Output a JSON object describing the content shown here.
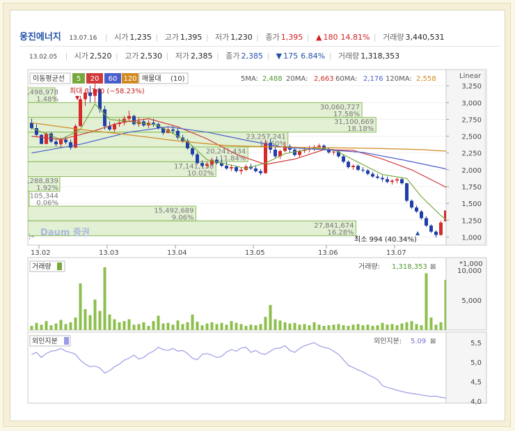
{
  "header": {
    "stock_name": "웅진에너지",
    "date": "13.07.16",
    "open_label": "시가",
    "open": "1,235",
    "high_label": "고가",
    "high": "1,395",
    "low_label": "저가",
    "low": "1,230",
    "close_label": "종가",
    "close": "1,395",
    "change_arrow": "▲",
    "change": "180",
    "change_pct": "14.81%",
    "volume_label": "거래량",
    "volume": "3,440,531"
  },
  "cursor_info": {
    "date": "13.02.05",
    "open_label": "시가",
    "open": "2,520",
    "high_label": "고가",
    "high": "2,530",
    "low_label": "저가",
    "low": "2,385",
    "close_label": "종가",
    "close": "2,385",
    "change_arrow": "▼",
    "change": "175",
    "change_pct": "6.84%",
    "volume_label": "거래량",
    "volume": "1,318,353"
  },
  "price_panel": {
    "ma_button": "이동평균선",
    "ma_periods": [
      "5",
      "20",
      "60",
      "120"
    ],
    "ma_colors": [
      "#78a83c",
      "#d03a3a",
      "#4a5dcc",
      "#d08a20"
    ],
    "volume_profile_button": "매물대",
    "volume_profile_count": "(10)",
    "ma_values": [
      {
        "label": "5MA:",
        "value": "2,488",
        "color": "#4c9a2a"
      },
      {
        "label": "20MA:",
        "value": "2,663",
        "color": "#d02a2a"
      },
      {
        "label": "60MA:",
        "value": "2,176",
        "color": "#4a5dcc"
      },
      {
        "label": "120MA:",
        "value": "2,558",
        "color": "#d08a20"
      }
    ],
    "scale_label": "Linear",
    "watermark": "Daum 증권",
    "max_label": "최대 3,340 (−58.23%)",
    "min_label": "최소 994 (40.34%)",
    "profile_labels": [
      {
        "volume": "2,498,978",
        "pct": "1.48%"
      },
      {
        "volume": "30,060,727",
        "pct": "17.58%"
      },
      {
        "volume": "31,100,669",
        "pct": "18.18%"
      },
      {
        "volume": "23,257,241",
        "pct": "13.60%"
      },
      {
        "volume": "20,241,434",
        "pct": "11.84%"
      },
      {
        "volume": "17,141,158",
        "pct": "10.02%"
      },
      {
        "volume": "3,288,839",
        "pct": "1.92%"
      },
      {
        "volume": "105,344",
        "pct": "0.06%"
      },
      {
        "volume": "15,492,689",
        "pct": "9.06%"
      },
      {
        "volume": "27,841,674",
        "pct": "16.28%"
      }
    ]
  },
  "volume_panel": {
    "button": "거래량",
    "multiplier": "*1,000",
    "value_label": "거래량:",
    "value": "1,318,353"
  },
  "foreign_panel": {
    "button": "외인지분",
    "value_label": "외인지분:",
    "value": "5.09"
  },
  "chart_data": [
    {
      "type": "candlestick",
      "title": "",
      "x_tick_labels": [
        "13.02",
        "13.03",
        "13.04",
        "13.05",
        "13.06",
        "13.07"
      ],
      "y_ticks": [
        1000,
        1250,
        1500,
        1750,
        2000,
        2250,
        2500,
        2750,
        3000,
        3250
      ],
      "y_tick_labels": [
        "1,000",
        "1,250",
        "1,500",
        "1,750",
        "2,000",
        "2,250",
        "2,500",
        "2,750",
        "3,000",
        "3,250"
      ],
      "ylim": [
        880,
        3480
      ],
      "n_periods": 96,
      "candles": [
        [
          2700,
          2760,
          2600,
          2620
        ],
        [
          2620,
          2680,
          2500,
          2520
        ],
        [
          2520,
          2530,
          2385,
          2385
        ],
        [
          2385,
          2560,
          2380,
          2540
        ],
        [
          2540,
          2560,
          2400,
          2420
        ],
        [
          2420,
          2450,
          2350,
          2380
        ],
        [
          2380,
          2480,
          2330,
          2450
        ],
        [
          2450,
          2500,
          2380,
          2410
        ],
        [
          2410,
          2450,
          2300,
          2330
        ],
        [
          2330,
          2680,
          2320,
          2650
        ],
        [
          2650,
          3100,
          2640,
          3050
        ],
        [
          3050,
          3200,
          2950,
          3150
        ],
        [
          3150,
          3250,
          3000,
          3100
        ],
        [
          3100,
          3340,
          3000,
          3200
        ],
        [
          3200,
          3220,
          2850,
          2900
        ],
        [
          2900,
          2950,
          2600,
          2650
        ],
        [
          2650,
          2720,
          2580,
          2600
        ],
        [
          2600,
          2700,
          2560,
          2680
        ],
        [
          2680,
          2760,
          2640,
          2700
        ],
        [
          2700,
          2800,
          2660,
          2760
        ],
        [
          2760,
          2880,
          2720,
          2800
        ],
        [
          2800,
          2820,
          2660,
          2680
        ],
        [
          2680,
          2780,
          2640,
          2720
        ],
        [
          2720,
          2760,
          2640,
          2660
        ],
        [
          2660,
          2740,
          2620,
          2700
        ],
        [
          2700,
          2760,
          2640,
          2680
        ],
        [
          2680,
          2700,
          2600,
          2620
        ],
        [
          2620,
          2640,
          2520,
          2550
        ],
        [
          2550,
          2640,
          2540,
          2600
        ],
        [
          2600,
          2660,
          2540,
          2580
        ],
        [
          2580,
          2620,
          2450,
          2480
        ],
        [
          2480,
          2520,
          2400,
          2430
        ],
        [
          2430,
          2460,
          2300,
          2320
        ],
        [
          2320,
          2350,
          2200,
          2230
        ],
        [
          2230,
          2260,
          2080,
          2100
        ],
        [
          2100,
          2140,
          2040,
          2060
        ],
        [
          2060,
          2120,
          2030,
          2080
        ],
        [
          2080,
          2180,
          2060,
          2150
        ],
        [
          2150,
          2200,
          2080,
          2100
        ],
        [
          2100,
          2150,
          2040,
          2060
        ],
        [
          2060,
          2120,
          2000,
          2020
        ],
        [
          2020,
          2080,
          1980,
          2040
        ],
        [
          2040,
          2060,
          1960,
          1980
        ],
        [
          1980,
          2040,
          1930,
          2000
        ],
        [
          2000,
          2080,
          1980,
          2050
        ],
        [
          2050,
          2090,
          2000,
          2020
        ],
        [
          2020,
          2060,
          1960,
          1980
        ],
        [
          1980,
          2010,
          1920,
          1950
        ],
        [
          1950,
          2450,
          1940,
          2400
        ],
        [
          2400,
          2460,
          2250,
          2300
        ],
        [
          2300,
          2340,
          2180,
          2200
        ],
        [
          2200,
          2300,
          2160,
          2280
        ],
        [
          2280,
          2420,
          2260,
          2350
        ],
        [
          2350,
          2380,
          2260,
          2300
        ],
        [
          2300,
          2320,
          2200,
          2220
        ],
        [
          2220,
          2300,
          2180,
          2280
        ],
        [
          2280,
          2340,
          2250,
          2300
        ],
        [
          2300,
          2360,
          2260,
          2320
        ],
        [
          2320,
          2370,
          2280,
          2340
        ],
        [
          2340,
          2390,
          2300,
          2360
        ],
        [
          2360,
          2380,
          2290,
          2310
        ],
        [
          2310,
          2330,
          2240,
          2260
        ],
        [
          2260,
          2300,
          2220,
          2270
        ],
        [
          2270,
          2290,
          2180,
          2200
        ],
        [
          2200,
          2220,
          2100,
          2120
        ],
        [
          2120,
          2140,
          2020,
          2040
        ],
        [
          2040,
          2080,
          2000,
          2060
        ],
        [
          2060,
          2080,
          1980,
          2000
        ],
        [
          2000,
          2040,
          1960,
          1990
        ],
        [
          1990,
          2010,
          1920,
          1940
        ],
        [
          1940,
          1970,
          1880,
          1900
        ],
        [
          1900,
          1940,
          1860,
          1880
        ],
        [
          1880,
          1920,
          1820,
          1860
        ],
        [
          1860,
          1900,
          1800,
          1820
        ],
        [
          1820,
          1860,
          1780,
          1840
        ],
        [
          1840,
          1880,
          1800,
          1860
        ],
        [
          1860,
          1880,
          1780,
          1800
        ],
        [
          1800,
          1810,
          1520,
          1540
        ],
        [
          1540,
          1560,
          1420,
          1440
        ],
        [
          1440,
          1470,
          1360,
          1380
        ],
        [
          1380,
          1400,
          1260,
          1280
        ],
        [
          1280,
          1310,
          1150,
          1170
        ],
        [
          1170,
          1190,
          1060,
          1080
        ],
        [
          1080,
          1100,
          994,
          1030
        ],
        [
          1030,
          1240,
          1020,
          1215
        ],
        [
          1235,
          1395,
          1230,
          1395
        ]
      ],
      "ma_series": [
        {
          "name": "5",
          "points": [
            [
              0,
              2620
            ],
            [
              6,
              2450
            ],
            [
              10,
              2600
            ],
            [
              13,
              2980
            ],
            [
              16,
              2750
            ],
            [
              20,
              2720
            ],
            [
              26,
              2660
            ],
            [
              32,
              2420
            ],
            [
              36,
              2150
            ],
            [
              44,
              2020
            ],
            [
              48,
              2100
            ],
            [
              52,
              2240
            ],
            [
              58,
              2320
            ],
            [
              62,
              2300
            ],
            [
              66,
              2150
            ],
            [
              72,
              1930
            ],
            [
              77,
              1870
            ],
            [
              80,
              1600
            ],
            [
              84,
              1320
            ],
            [
              87,
              1150
            ],
            [
              89,
              1180
            ]
          ]
        },
        {
          "name": "20",
          "points": [
            [
              0,
              2500
            ],
            [
              6,
              2450
            ],
            [
              12,
              2560
            ],
            [
              18,
              2700
            ],
            [
              24,
              2760
            ],
            [
              30,
              2640
            ],
            [
              36,
              2460
            ],
            [
              42,
              2230
            ],
            [
              48,
              2080
            ],
            [
              54,
              2160
            ],
            [
              60,
              2300
            ],
            [
              66,
              2290
            ],
            [
              72,
              2160
            ],
            [
              78,
              2000
            ],
            [
              84,
              1780
            ],
            [
              89,
              1580
            ]
          ]
        },
        {
          "name": "60",
          "points": [
            [
              0,
              2250
            ],
            [
              10,
              2380
            ],
            [
              20,
              2560
            ],
            [
              28,
              2640
            ],
            [
              36,
              2560
            ],
            [
              44,
              2440
            ],
            [
              52,
              2330
            ],
            [
              60,
              2300
            ],
            [
              68,
              2260
            ],
            [
              76,
              2150
            ],
            [
              84,
              2030
            ],
            [
              89,
              1950
            ]
          ]
        },
        {
          "name": "120",
          "points": [
            [
              0,
              2700
            ],
            [
              10,
              2600
            ],
            [
              20,
              2520
            ],
            [
              30,
              2430
            ],
            [
              40,
              2360
            ],
            [
              50,
              2340
            ],
            [
              60,
              2330
            ],
            [
              70,
              2320
            ],
            [
              80,
              2300
            ],
            [
              89,
              2260
            ]
          ]
        }
      ],
      "volume_profile": [
        {
          "price_from": 3000,
          "price_to": 3220,
          "pct": 6.8
        },
        {
          "price_from": 2780,
          "price_to": 3000,
          "pct": 83.5
        },
        {
          "price_from": 2560,
          "price_to": 2780,
          "pct": 87.0
        },
        {
          "price_from": 2340,
          "price_to": 2560,
          "pct": 65.0
        },
        {
          "price_from": 2120,
          "price_to": 2340,
          "pct": 55.0
        },
        {
          "price_from": 1900,
          "price_to": 2120,
          "pct": 47.0
        },
        {
          "price_from": 1680,
          "price_to": 1900,
          "pct": 8.0
        },
        {
          "price_from": 1460,
          "price_to": 1680,
          "pct": 0.3
        },
        {
          "price_from": 1240,
          "price_to": 1460,
          "pct": 42.0
        },
        {
          "price_from": 1020,
          "price_to": 1240,
          "pct": 82.0
        }
      ]
    },
    {
      "type": "bar",
      "title": "",
      "y_ticks": [
        5000,
        10000
      ],
      "y_tick_labels": [
        "5,000",
        "10,000"
      ],
      "ylim": [
        0,
        12000
      ],
      "values": [
        700,
        1200,
        900,
        1500,
        800,
        1100,
        1700,
        1000,
        1300,
        2100,
        7800,
        3500,
        2500,
        5100,
        3200,
        10500,
        2600,
        1800,
        1300,
        1500,
        1800,
        900,
        1000,
        1300,
        700,
        1500,
        2400,
        1100,
        1200,
        900,
        1600,
        1000,
        1300,
        2600,
        1400,
        800,
        1100,
        1300,
        1000,
        1200,
        900,
        1500,
        1200,
        1000,
        700,
        900,
        800,
        1000,
        2200,
        4200,
        1800,
        1600,
        1300,
        1100,
        1200,
        900,
        1000,
        800,
        1300,
        900,
        700,
        800,
        900,
        1000,
        800,
        700,
        900,
        1000,
        800,
        900,
        700,
        800,
        1200,
        900,
        1000,
        800,
        1100,
        1300,
        1500,
        1000,
        800,
        9500,
        2100,
        900,
        1300,
        8400,
        10200,
        6200,
        3100
      ]
    },
    {
      "type": "line",
      "title": "",
      "y_ticks": [
        4.0,
        4.5,
        5.0,
        5.5
      ],
      "y_tick_labels": [
        "4,0",
        "4,5",
        "5,0",
        "5,5"
      ],
      "ylim": [
        3.95,
        5.75
      ],
      "values": [
        5.2,
        5.25,
        5.12,
        5.22,
        5.28,
        5.3,
        5.35,
        5.28,
        5.25,
        5.2,
        5.05,
        4.95,
        4.88,
        4.9,
        4.85,
        4.72,
        4.78,
        4.88,
        4.95,
        5.05,
        5.1,
        5.18,
        5.08,
        5.12,
        5.22,
        5.28,
        5.38,
        5.32,
        5.3,
        5.35,
        5.28,
        5.3,
        5.22,
        5.1,
        5.06,
        5.2,
        5.22,
        5.18,
        5.12,
        5.15,
        5.26,
        5.32,
        5.28,
        5.36,
        5.38,
        5.25,
        5.3,
        5.22,
        5.2,
        5.28,
        5.35,
        5.36,
        5.42,
        5.3,
        5.25,
        5.35,
        5.42,
        5.46,
        5.5,
        5.42,
        5.38,
        5.35,
        5.28,
        5.2,
        5.06,
        4.92,
        4.86,
        4.8,
        4.75,
        4.68,
        4.62,
        4.55,
        4.4,
        4.35,
        4.32,
        4.28,
        4.25,
        4.22,
        4.2,
        4.18,
        4.16,
        4.14,
        4.12,
        4.13,
        4.1,
        4.08,
        4.04,
        4.0,
        3.98,
        3.96
      ]
    }
  ]
}
